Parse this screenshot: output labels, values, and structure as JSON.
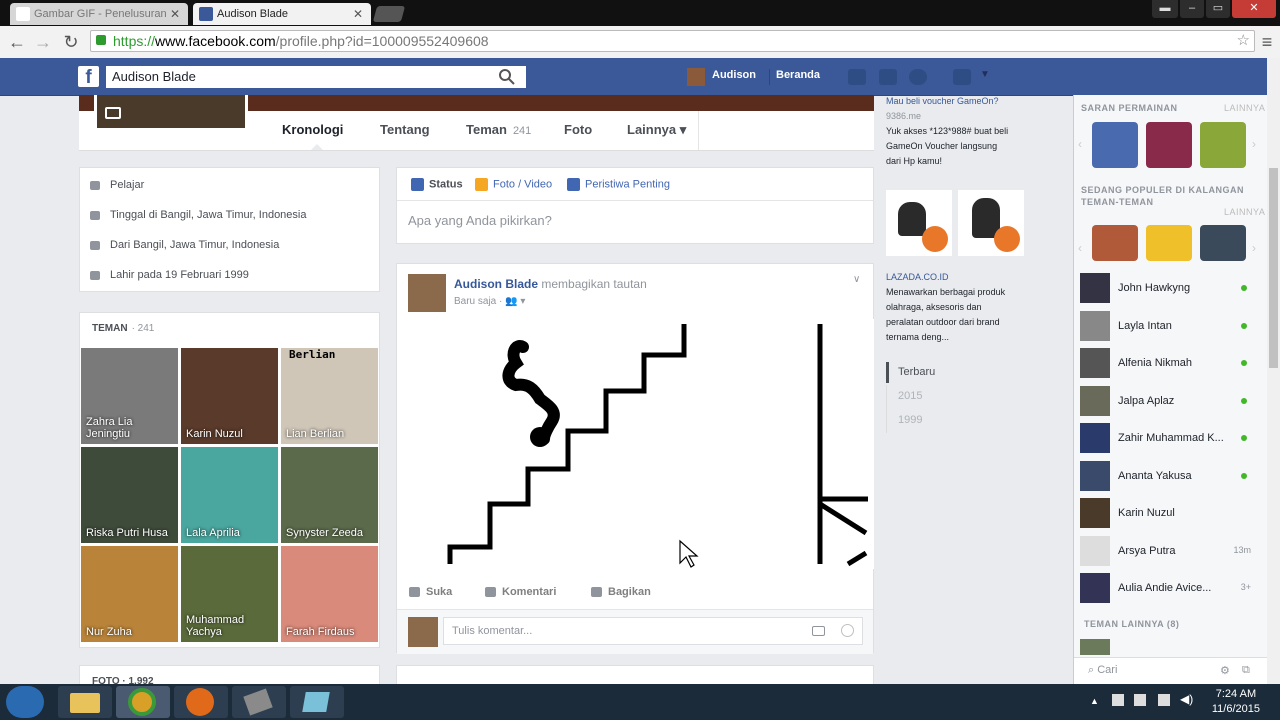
{
  "browser": {
    "tabs": [
      {
        "label": "Gambar GIF - Penelusuran"
      },
      {
        "label": "Audison Blade"
      }
    ],
    "url_https": "https://",
    "url_domain": "www.facebook.com",
    "url_path": "/profile.php?id=100009552409608"
  },
  "fbbar": {
    "logo": "f",
    "search_value": "Audison Blade",
    "user_name": "Audison",
    "home": "Beranda"
  },
  "timeline_nav": {
    "items": [
      {
        "label": "Kronologi"
      },
      {
        "label": "Tentang"
      },
      {
        "label": "Teman",
        "count": "241"
      },
      {
        "label": "Foto"
      },
      {
        "label": "Lainnya ▾"
      }
    ]
  },
  "intro": {
    "items": [
      "Pelajar",
      "Tinggal di Bangil, Jawa Timur, Indonesia",
      "Dari Bangil, Jawa Timur, Indonesia",
      "Lahir pada 19 Februari 1999"
    ]
  },
  "friends": {
    "header": "TEMAN",
    "count": "241",
    "items": [
      {
        "name": "Zahra Lia Jeningtiu",
        "color": "#7a7a7a"
      },
      {
        "name": "Karin Nuzul",
        "color": "#5a3a2a"
      },
      {
        "name": "Lian Berlian",
        "overlay": "Berlian",
        "color": "#cfc6b8"
      },
      {
        "name": "Riska Putri Husa",
        "color": "#3e4a3a"
      },
      {
        "name": "Lala Aprilia",
        "color": "#4aa7a0"
      },
      {
        "name": "Synyster Zeeda",
        "color": "#5b6a4a"
      },
      {
        "name": "Nur Zuha",
        "color": "#b9843a"
      },
      {
        "name": "Muhammad Yachya",
        "color": "#5a6a3a"
      },
      {
        "name": "Farah Firdaus",
        "color": "#d98a7a"
      }
    ]
  },
  "bottom_left_header": "FOTO · 1.992",
  "composer": {
    "tabs": [
      {
        "label": "Status",
        "color": "#4267b2"
      },
      {
        "label": "Foto / Video",
        "color": "#f5a623"
      },
      {
        "label": "Peristiwa Penting",
        "color": "#4267b2"
      }
    ],
    "placeholder": "Apa yang Anda pikirkan?"
  },
  "post": {
    "author": "Audison Blade",
    "action": "membagikan tautan",
    "time": "Baru saja · ",
    "actions": [
      "Suka",
      "Komentari",
      "Bagikan"
    ],
    "comment_placeholder": "Tulis komentar..."
  },
  "ads": {
    "top_lines": [
      "Mau beli voucher GameOn?",
      "9386.me",
      "Yuk akses *123*988# buat beli",
      "GameOn Voucher langsung",
      "dari Hp kamu!"
    ],
    "lazada_domain": "LAZADA.CO.ID",
    "lazada_lines": [
      "Menawarkan berbagai produk",
      "olahraga, aksesoris dan",
      "peralatan outdoor dari brand",
      "ternama deng..."
    ]
  },
  "timeline_years": [
    "Terbaru",
    "2015",
    "1999"
  ],
  "chat": {
    "games_header": "SARAN PERMAINAN",
    "games_more": "LAINNYA",
    "popular_header": "SEDANG POPULER DI KALANGAN TEMAN-TEMAN",
    "popular_more": "LAINNYA",
    "contacts": [
      {
        "name": "John Hawkyng",
        "online": true,
        "color": "#334"
      },
      {
        "name": "Layla Intan",
        "online": true,
        "color": "#888"
      },
      {
        "name": "Alfenia Nikmah",
        "online": true,
        "color": "#555"
      },
      {
        "name": "Jalpa Aplaz",
        "online": true,
        "color": "#6a6a5a"
      },
      {
        "name": "Zahir Muhammad K...",
        "online": true,
        "color": "#2a3a6a"
      },
      {
        "name": "Ananta Yakusa",
        "online": true,
        "color": "#3a4a6a"
      },
      {
        "name": "Karin Nuzul",
        "online": false,
        "color": "#4a3a2a"
      },
      {
        "name": "Arsya Putra",
        "online": false,
        "time": "13m",
        "color": "#ddd"
      },
      {
        "name": "Aulia Andie Avice...",
        "online": false,
        "time": "3+",
        "color": "#335"
      }
    ],
    "others_header": "TEMAN LAINNYA (8)",
    "search_placeholder": "Cari"
  },
  "taskbar": {
    "time": "7:24 AM",
    "date": "11/6/2015"
  }
}
